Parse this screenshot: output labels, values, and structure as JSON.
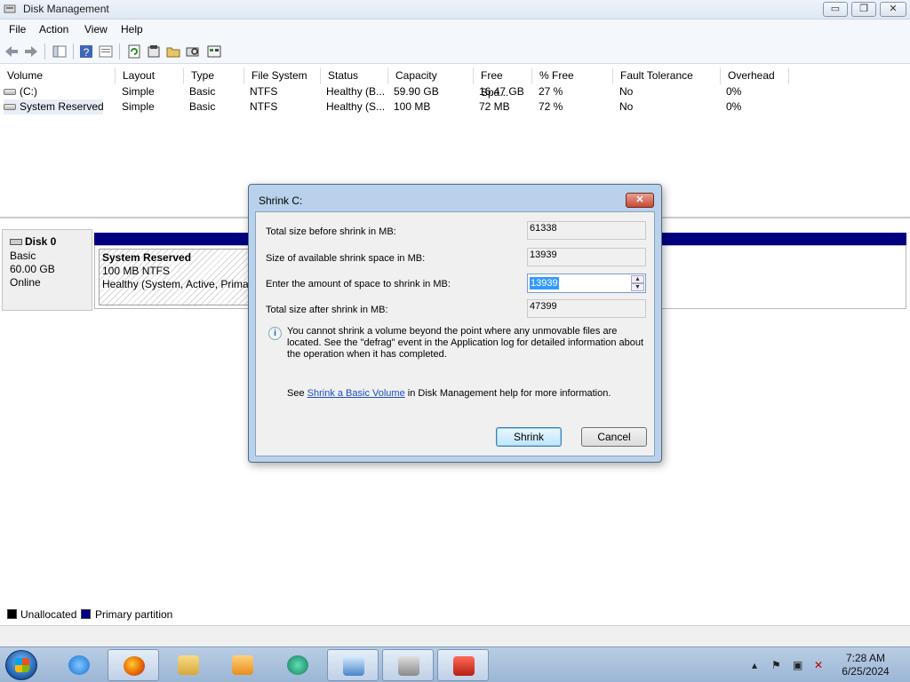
{
  "window": {
    "title": "Disk Management",
    "controls": {
      "minimize": "▭",
      "restore": "❐",
      "close": "✕"
    }
  },
  "menu": [
    "File",
    "Action",
    "View",
    "Help"
  ],
  "toolbar": {
    "icons": [
      "back-arrow-icon",
      "forward-arrow-icon",
      "console-tree-icon",
      "help-icon",
      "help-topics-icon",
      "refresh-icon",
      "properties-icon",
      "open-icon",
      "rescan-icon",
      "settings-icon"
    ]
  },
  "volume_list": {
    "columns": [
      "Volume",
      "Layout",
      "Type",
      "File System",
      "Status",
      "Capacity",
      "Free Spa...",
      "% Free",
      "Fault Tolerance",
      "Overhead"
    ],
    "rows": [
      {
        "volume": "(C:)",
        "layout": "Simple",
        "type": "Basic",
        "fs": "NTFS",
        "status": "Healthy (B...",
        "capacity": "59.90 GB",
        "free": "16.47 GB",
        "pct_free": "27 %",
        "fault": "No",
        "overhead": "0%"
      },
      {
        "volume": "System Reserved",
        "layout": "Simple",
        "type": "Basic",
        "fs": "NTFS",
        "status": "Healthy (S...",
        "capacity": "100 MB",
        "free": "72 MB",
        "pct_free": "72 %",
        "fault": "No",
        "overhead": "0%"
      }
    ]
  },
  "disk": {
    "name": "Disk 0",
    "type": "Basic",
    "size": "60.00 GB",
    "state": "Online",
    "partition": {
      "name": "System Reserved",
      "size_fs": "100 MB NTFS",
      "status": "Healthy (System, Active, Primar"
    },
    "bar_color": "#000080"
  },
  "legend": [
    {
      "label": "Unallocated",
      "color": "#000000"
    },
    {
      "label": "Primary partition",
      "color": "#000080"
    }
  ],
  "dialog": {
    "title": "Shrink C:",
    "close_glyph": "✕",
    "fields": {
      "total_before_label": "Total size before shrink in MB:",
      "total_before_value": "61338",
      "available_label": "Size of available shrink space in MB:",
      "available_value": "13939",
      "amount_label": "Enter the amount of space to shrink in MB:",
      "amount_value": "13939",
      "after_label": "Total size after shrink in MB:",
      "after_value": "47399"
    },
    "info_text": "You cannot shrink a volume beyond the point where any unmovable files are located. See the \"defrag\" event in the Application log for detailed information about the operation when it has completed.",
    "help_prefix": "See ",
    "help_link": "Shrink a Basic Volume",
    "help_suffix": " in Disk Management help for more information.",
    "shrink_button": "Shrink",
    "cancel_button": "Cancel"
  },
  "taskbar": {
    "apps": [
      "internet-explorer-icon",
      "firefox-icon",
      "file-explorer-icon",
      "media-player-icon",
      "app-icon",
      "remote-desktop-icon",
      "server-icon",
      "toolbox-icon"
    ],
    "time": "7:28 AM",
    "date": "6/25/2024"
  }
}
